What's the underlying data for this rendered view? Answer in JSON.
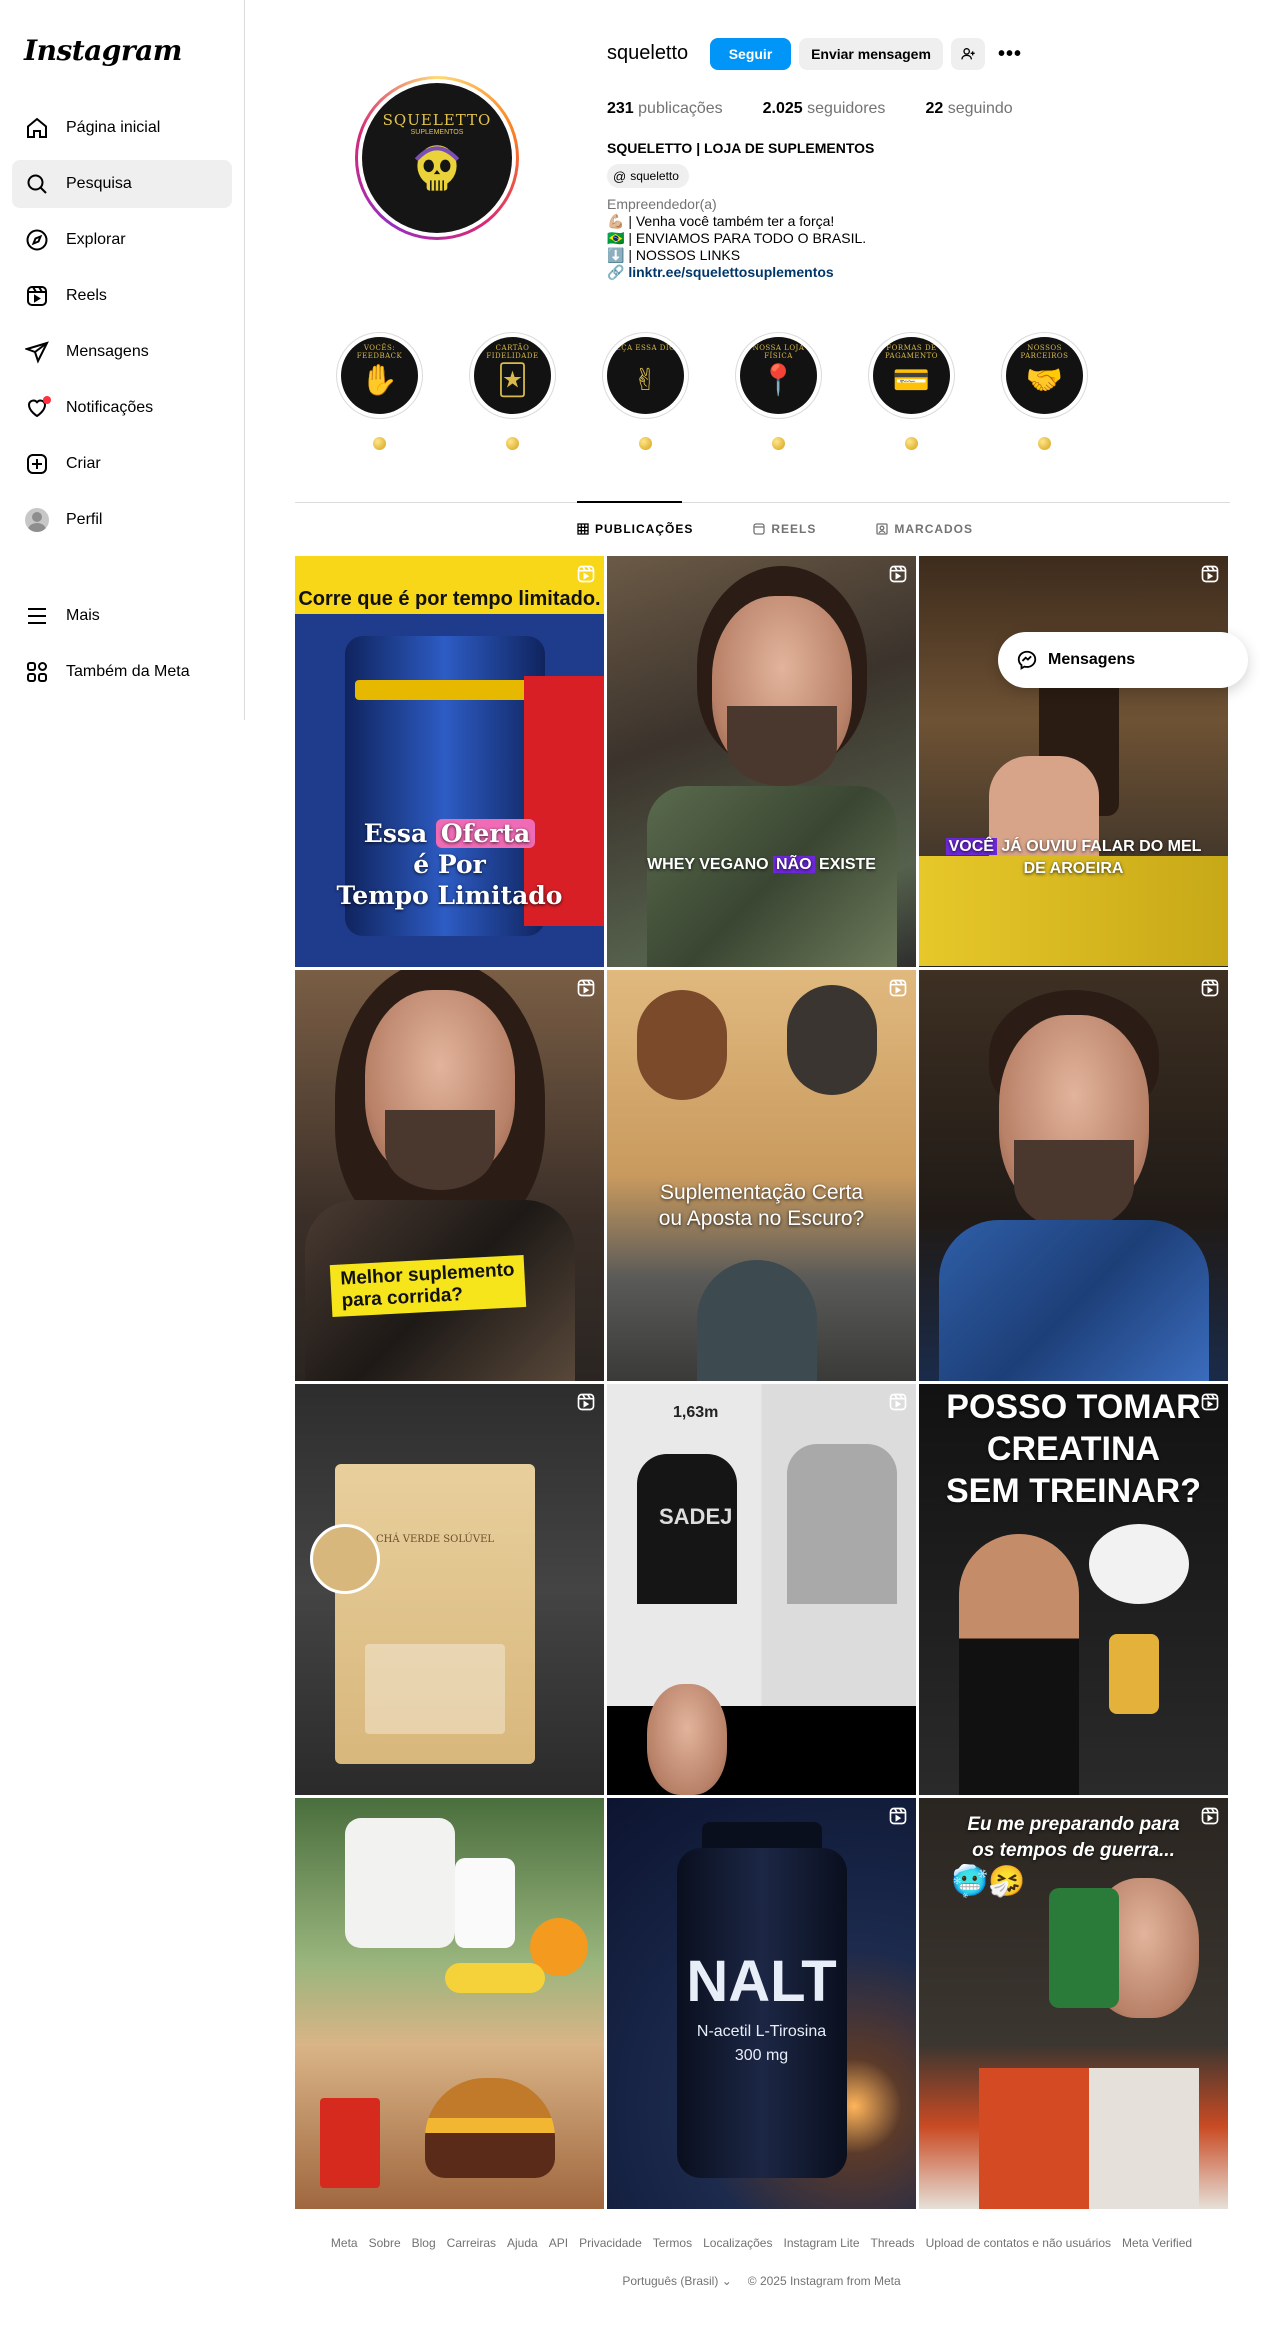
{
  "app": {
    "logo": "Instagram"
  },
  "sidebar": {
    "items": [
      {
        "label": "Página inicial",
        "icon": "home-icon"
      },
      {
        "label": "Pesquisa",
        "icon": "search-icon",
        "active": true
      },
      {
        "label": "Explorar",
        "icon": "compass-icon"
      },
      {
        "label": "Reels",
        "icon": "reels-icon"
      },
      {
        "label": "Mensagens",
        "icon": "send-icon"
      },
      {
        "label": "Notificações",
        "icon": "heart-icon"
      },
      {
        "label": "Criar",
        "icon": "plus-square-icon"
      },
      {
        "label": "Perfil",
        "icon": "avatar"
      }
    ],
    "lower": [
      {
        "label": "Mais",
        "icon": "menu-icon"
      },
      {
        "label": "Também da Meta",
        "icon": "meta-apps-icon"
      }
    ]
  },
  "profile": {
    "username": "squeletto",
    "follow_label": "Seguir",
    "message_label": "Enviar mensagem",
    "more_label": "•••",
    "posts_count": "231",
    "posts_label": "publicações",
    "followers_count": "2.025",
    "followers_label": "seguidores",
    "following_count": "22",
    "following_label": "seguindo",
    "full_name": "SQUELETTO | LOJA DE SUPLEMENTOS",
    "threads_handle": "squeletto",
    "category": "Empreendedor(a)",
    "bio_lines": [
      "💪🏼 | Venha você também ter a força!",
      "🇧🇷 | ENVIAMOS PARA TODO O BRASIL.",
      "⬇️ | NOSSOS LINKS"
    ],
    "link": "linktr.ee/squelettosuplementos",
    "pic_brand": "SQUELETTO",
    "pic_brand_sub": "SUPLEMENTOS"
  },
  "highlights": [
    {
      "arc": "VOCÊS: FEEDBACK",
      "glyph": "✋"
    },
    {
      "arc": "CARTÃO FIDELIDADE",
      "glyph": "🃏"
    },
    {
      "arc": "PEÇA ESSA DICA",
      "glyph": "✌"
    },
    {
      "arc": "NOSSA LOJA FÍSICA",
      "glyph": "📍"
    },
    {
      "arc": "FORMAS DE PAGAMENTO",
      "glyph": "💳"
    },
    {
      "arc": "NOSSOS PARCEIROS",
      "glyph": "🤝"
    }
  ],
  "tabs": [
    {
      "label": "PUBLICAÇÕES",
      "active": true
    },
    {
      "label": "REELS"
    },
    {
      "label": "MARCADOS"
    }
  ],
  "posts": {
    "p1": {
      "top": "Corre que é por tempo limitado.",
      "line1_a": "Essa ",
      "line1_hl": "Oferta",
      "line2": "é Por",
      "line3": "Tempo Limitado"
    },
    "p2": {
      "a": "WHEY VEGANO ",
      "hl": "NÃO",
      "b": " EXISTE"
    },
    "p3": {
      "hl": "VOCÊ",
      "a": " JÁ OUVIU FALAR DO MEL",
      "b": "DE AROEIRA"
    },
    "p4": {
      "line1": "Melhor suplemento",
      "line2": "para corrida?"
    },
    "p5": {
      "line1": "Suplementação Certa",
      "line2": "ou Aposta no Escuro?"
    },
    "p7": {
      "label": "CHÁ VERDE SOLÚVEL"
    },
    "p8": {
      "height": "1,63m",
      "shirt": "SADEJ"
    },
    "p9": {
      "line1": "POSSO TOMAR",
      "line2": "CREATINA",
      "line3": "SEM TREINAR?"
    },
    "p11": {
      "big": "NALT",
      "sub1": "N-acetil L-Tirosina",
      "sub2": "300 mg"
    },
    "p12": {
      "line1": "Eu me preparando para",
      "line2": "os tempos de guerra...",
      "emoji": "🥶🤧"
    }
  },
  "messages_pill": "Mensagens",
  "footer": {
    "links": [
      "Meta",
      "Sobre",
      "Blog",
      "Carreiras",
      "Ajuda",
      "API",
      "Privacidade",
      "Termos",
      "Localizações",
      "Instagram Lite",
      "Threads",
      "Upload de contatos e não usuários",
      "Meta Verified"
    ],
    "language": "Português (Brasil)",
    "copyright": "© 2025 Instagram from Meta"
  }
}
